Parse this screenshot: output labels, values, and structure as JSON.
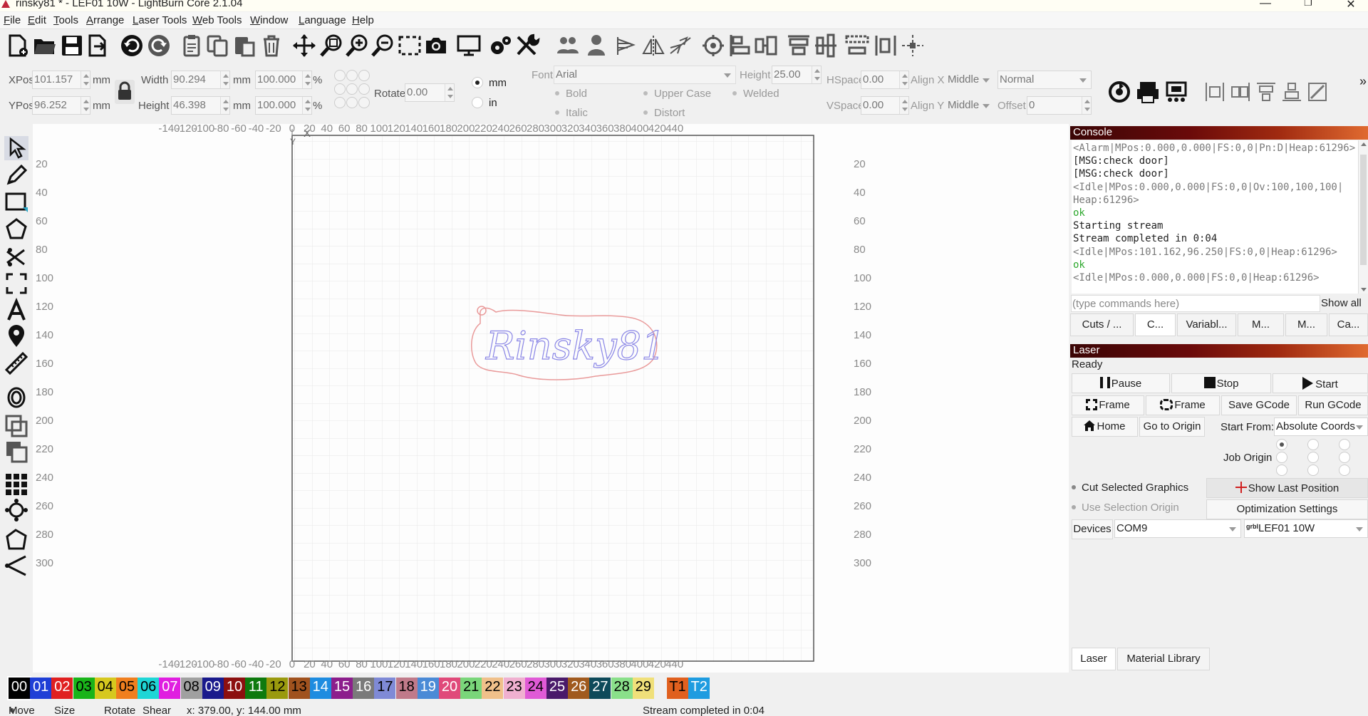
{
  "window": {
    "title": "rinsky81 * - LEF01 10W - LightBurn Core 2.1.04",
    "btn_minimize": "—",
    "btn_maximize": "❐",
    "btn_close": "✕"
  },
  "menu": [
    "File",
    "Edit",
    "Tools",
    "Arrange",
    "Laser Tools",
    "Web Tools",
    "Window",
    "Language",
    "Help"
  ],
  "toolbar_icons": [
    "new-file-icon",
    "open-folder-icon",
    "save-icon",
    "export-icon",
    "undo-icon",
    "redo-icon",
    "paste-clipboard-icon",
    "copy-icon",
    "paste-icon",
    "delete-trash-icon",
    "move-cross-icon",
    "zoom-fit-icon",
    "zoom-in-icon",
    "zoom-out-icon",
    "zoom-selection-icon",
    "camera-icon",
    "monitor-icon",
    "settings-gears-icon",
    "tools-wrench-icon",
    "group-icon",
    "ungroup-person-icon",
    "align-flip-h-icon",
    "mirror-icon",
    "weld-icon",
    "target-icon",
    "align-left-icon",
    "align-center-icon",
    "align-top-icon",
    "align-middle-icon",
    "distribute-icon",
    "distribute-v-icon",
    "center-cross-icon"
  ],
  "props": {
    "xpos_label": "XPos",
    "xpos_value": "101.157",
    "ypos_label": "YPos",
    "ypos_value": "96.252",
    "unit_mm": "mm",
    "width_label": "Width",
    "width_value": "90.294",
    "height_label": "Height",
    "height_value": "46.398",
    "scale_w": "100.000",
    "scale_h": "100.000",
    "percent": "%",
    "rotate_label": "Rotate",
    "rotate_value": "0.00",
    "units_mm": "mm",
    "units_in": "in",
    "font_label": "Font",
    "font_value": "Arial",
    "font_height_label": "Height",
    "font_height_value": "25.00",
    "bold": "Bold",
    "italic": "Italic",
    "upper_case": "Upper Case",
    "distort": "Distort",
    "welded": "Welded",
    "hspace_label": "HSpace",
    "hspace_value": "0.00",
    "vspace_label": "VSpace",
    "vspace_value": "0.00",
    "alignx_label": "Align X",
    "alignx_value": "Middle",
    "aligny_label": "Align Y",
    "aligny_value": "Middle",
    "mode_value": "Normal",
    "offset_label": "Offset",
    "offset_value": "0",
    "more": "»"
  },
  "ruler": {
    "top": [
      "-140",
      "-120",
      "-100",
      "-80",
      "-60",
      "-40",
      "-20",
      "0",
      "20",
      "40",
      "60",
      "80",
      "100",
      "120",
      "140",
      "160",
      "180",
      "200",
      "220",
      "240",
      "260",
      "280",
      "300",
      "320",
      "340",
      "360",
      "380",
      "400",
      "420",
      "440"
    ],
    "side": [
      "20",
      "40",
      "60",
      "80",
      "100",
      "120",
      "140",
      "160",
      "180",
      "200",
      "220",
      "240",
      "260",
      "280",
      "300"
    ],
    "x_marker": "X",
    "y_marker": "Y"
  },
  "design_text": "Rinsky81",
  "console": {
    "title": "Console",
    "lines": [
      {
        "t": "<Alarm|MPos:0.000,0.000|FS:0,0|Pn:D|Heap:61296>",
        "c": "gray"
      },
      {
        "t": "[MSG:check door]",
        "c": "black"
      },
      {
        "t": "[MSG:check door]",
        "c": "black"
      },
      {
        "t": "<Idle|MPos:0.000,0.000|FS:0,0|Ov:100,100,100|",
        "c": "gray"
      },
      {
        "t": "Heap:61296>",
        "c": "gray"
      },
      {
        "t": "ok",
        "c": "green"
      },
      {
        "t": "Starting stream",
        "c": "black"
      },
      {
        "t": "Stream completed in 0:04",
        "c": "black"
      },
      {
        "t": "<Idle|MPos:101.162,96.250|FS:0,0|Heap:61296>",
        "c": "gray"
      },
      {
        "t": "ok",
        "c": "green"
      },
      {
        "t": "<Idle|MPos:0.000,0.000|FS:0,0|Heap:61296>",
        "c": "gray"
      }
    ],
    "input_placeholder": "(type commands here)",
    "show_all": "Show all"
  },
  "panel_tabs": [
    "Cuts / ...",
    "C...",
    "Variabl...",
    "M...",
    "M...",
    "Ca..."
  ],
  "laser": {
    "title": "Laser",
    "status": "Ready",
    "pause": "Pause",
    "stop": "Stop",
    "start": "Start",
    "frame1": "Frame",
    "frame2": "Frame",
    "save_gcode": "Save GCode",
    "run_gcode": "Run GCode",
    "home": "Home",
    "go_origin": "Go to Origin",
    "start_from_label": "Start From:",
    "start_from_value": "Absolute Coords",
    "job_origin": "Job Origin",
    "cut_selected": "Cut Selected Graphics",
    "use_selection_origin": "Use Selection Origin",
    "show_last_position": "Show Last Position",
    "optimization": "Optimization Settings",
    "devices": "Devices",
    "port": "COM9",
    "device_prefix": "grbl",
    "device": "LEF01 10W"
  },
  "bottom_tabs": [
    "Laser",
    "Material Library"
  ],
  "palette": [
    {
      "label": "00",
      "color": "#000000",
      "fg": "#ffffff"
    },
    {
      "label": "01",
      "color": "#1f3fd6",
      "fg": "#ffffff"
    },
    {
      "label": "02",
      "color": "#e02020",
      "fg": "#ffffff"
    },
    {
      "label": "03",
      "color": "#19b419",
      "fg": "#000000"
    },
    {
      "label": "04",
      "color": "#d6c81e",
      "fg": "#000000"
    },
    {
      "label": "05",
      "color": "#f07f1e",
      "fg": "#000000"
    },
    {
      "label": "06",
      "color": "#1ed6d6",
      "fg": "#000000"
    },
    {
      "label": "07",
      "color": "#e01ee0",
      "fg": "#ffffff"
    },
    {
      "label": "08",
      "color": "#a0a0a0",
      "fg": "#000000"
    },
    {
      "label": "09",
      "color": "#1a1a8c",
      "fg": "#ffffff"
    },
    {
      "label": "10",
      "color": "#8c1010",
      "fg": "#ffffff"
    },
    {
      "label": "11",
      "color": "#0e7a0e",
      "fg": "#ffffff"
    },
    {
      "label": "12",
      "color": "#9a9a0e",
      "fg": "#000000"
    },
    {
      "label": "13",
      "color": "#a0521e",
      "fg": "#000000"
    },
    {
      "label": "14",
      "color": "#1e8ce0",
      "fg": "#ffffff"
    },
    {
      "label": "15",
      "color": "#8c1e8c",
      "fg": "#ffffff"
    },
    {
      "label": "16",
      "color": "#7a7a7a",
      "fg": "#ffffff"
    },
    {
      "label": "17",
      "color": "#7f8ad6",
      "fg": "#000000"
    },
    {
      "label": "18",
      "color": "#c07a8a",
      "fg": "#000000"
    },
    {
      "label": "19",
      "color": "#4a8ad6",
      "fg": "#ffffff"
    },
    {
      "label": "20",
      "color": "#e04a7a",
      "fg": "#ffffff"
    },
    {
      "label": "21",
      "color": "#7ad67a",
      "fg": "#000000"
    },
    {
      "label": "22",
      "color": "#f0c08a",
      "fg": "#000000"
    },
    {
      "label": "23",
      "color": "#f0b0d0",
      "fg": "#000000"
    },
    {
      "label": "24",
      "color": "#e05ad6",
      "fg": "#000000"
    },
    {
      "label": "25",
      "color": "#4a1a6a",
      "fg": "#ffffff"
    },
    {
      "label": "26",
      "color": "#a05a1e",
      "fg": "#ffffff"
    },
    {
      "label": "27",
      "color": "#0e4a5a",
      "fg": "#ffffff"
    },
    {
      "label": "28",
      "color": "#8ae08a",
      "fg": "#000000"
    },
    {
      "label": "29",
      "color": "#f0e07a",
      "fg": "#000000"
    },
    {
      "label": "T1",
      "color": "#e0601e",
      "fg": "#000000"
    },
    {
      "label": "T2",
      "color": "#1e9ce0",
      "fg": "#ffffff"
    }
  ],
  "status": {
    "move": "Move",
    "size": "Size",
    "rotate": "Rotate",
    "shear": "Shear",
    "coords": "x: 379.00, y: 144.00 mm",
    "message": "Stream completed in 0:04"
  },
  "colors": {
    "accent_dark": "#3a0505",
    "accent_orange": "#e06a30",
    "design_stroke": "#7a7ae0",
    "design_outline": "#e87a7a"
  }
}
